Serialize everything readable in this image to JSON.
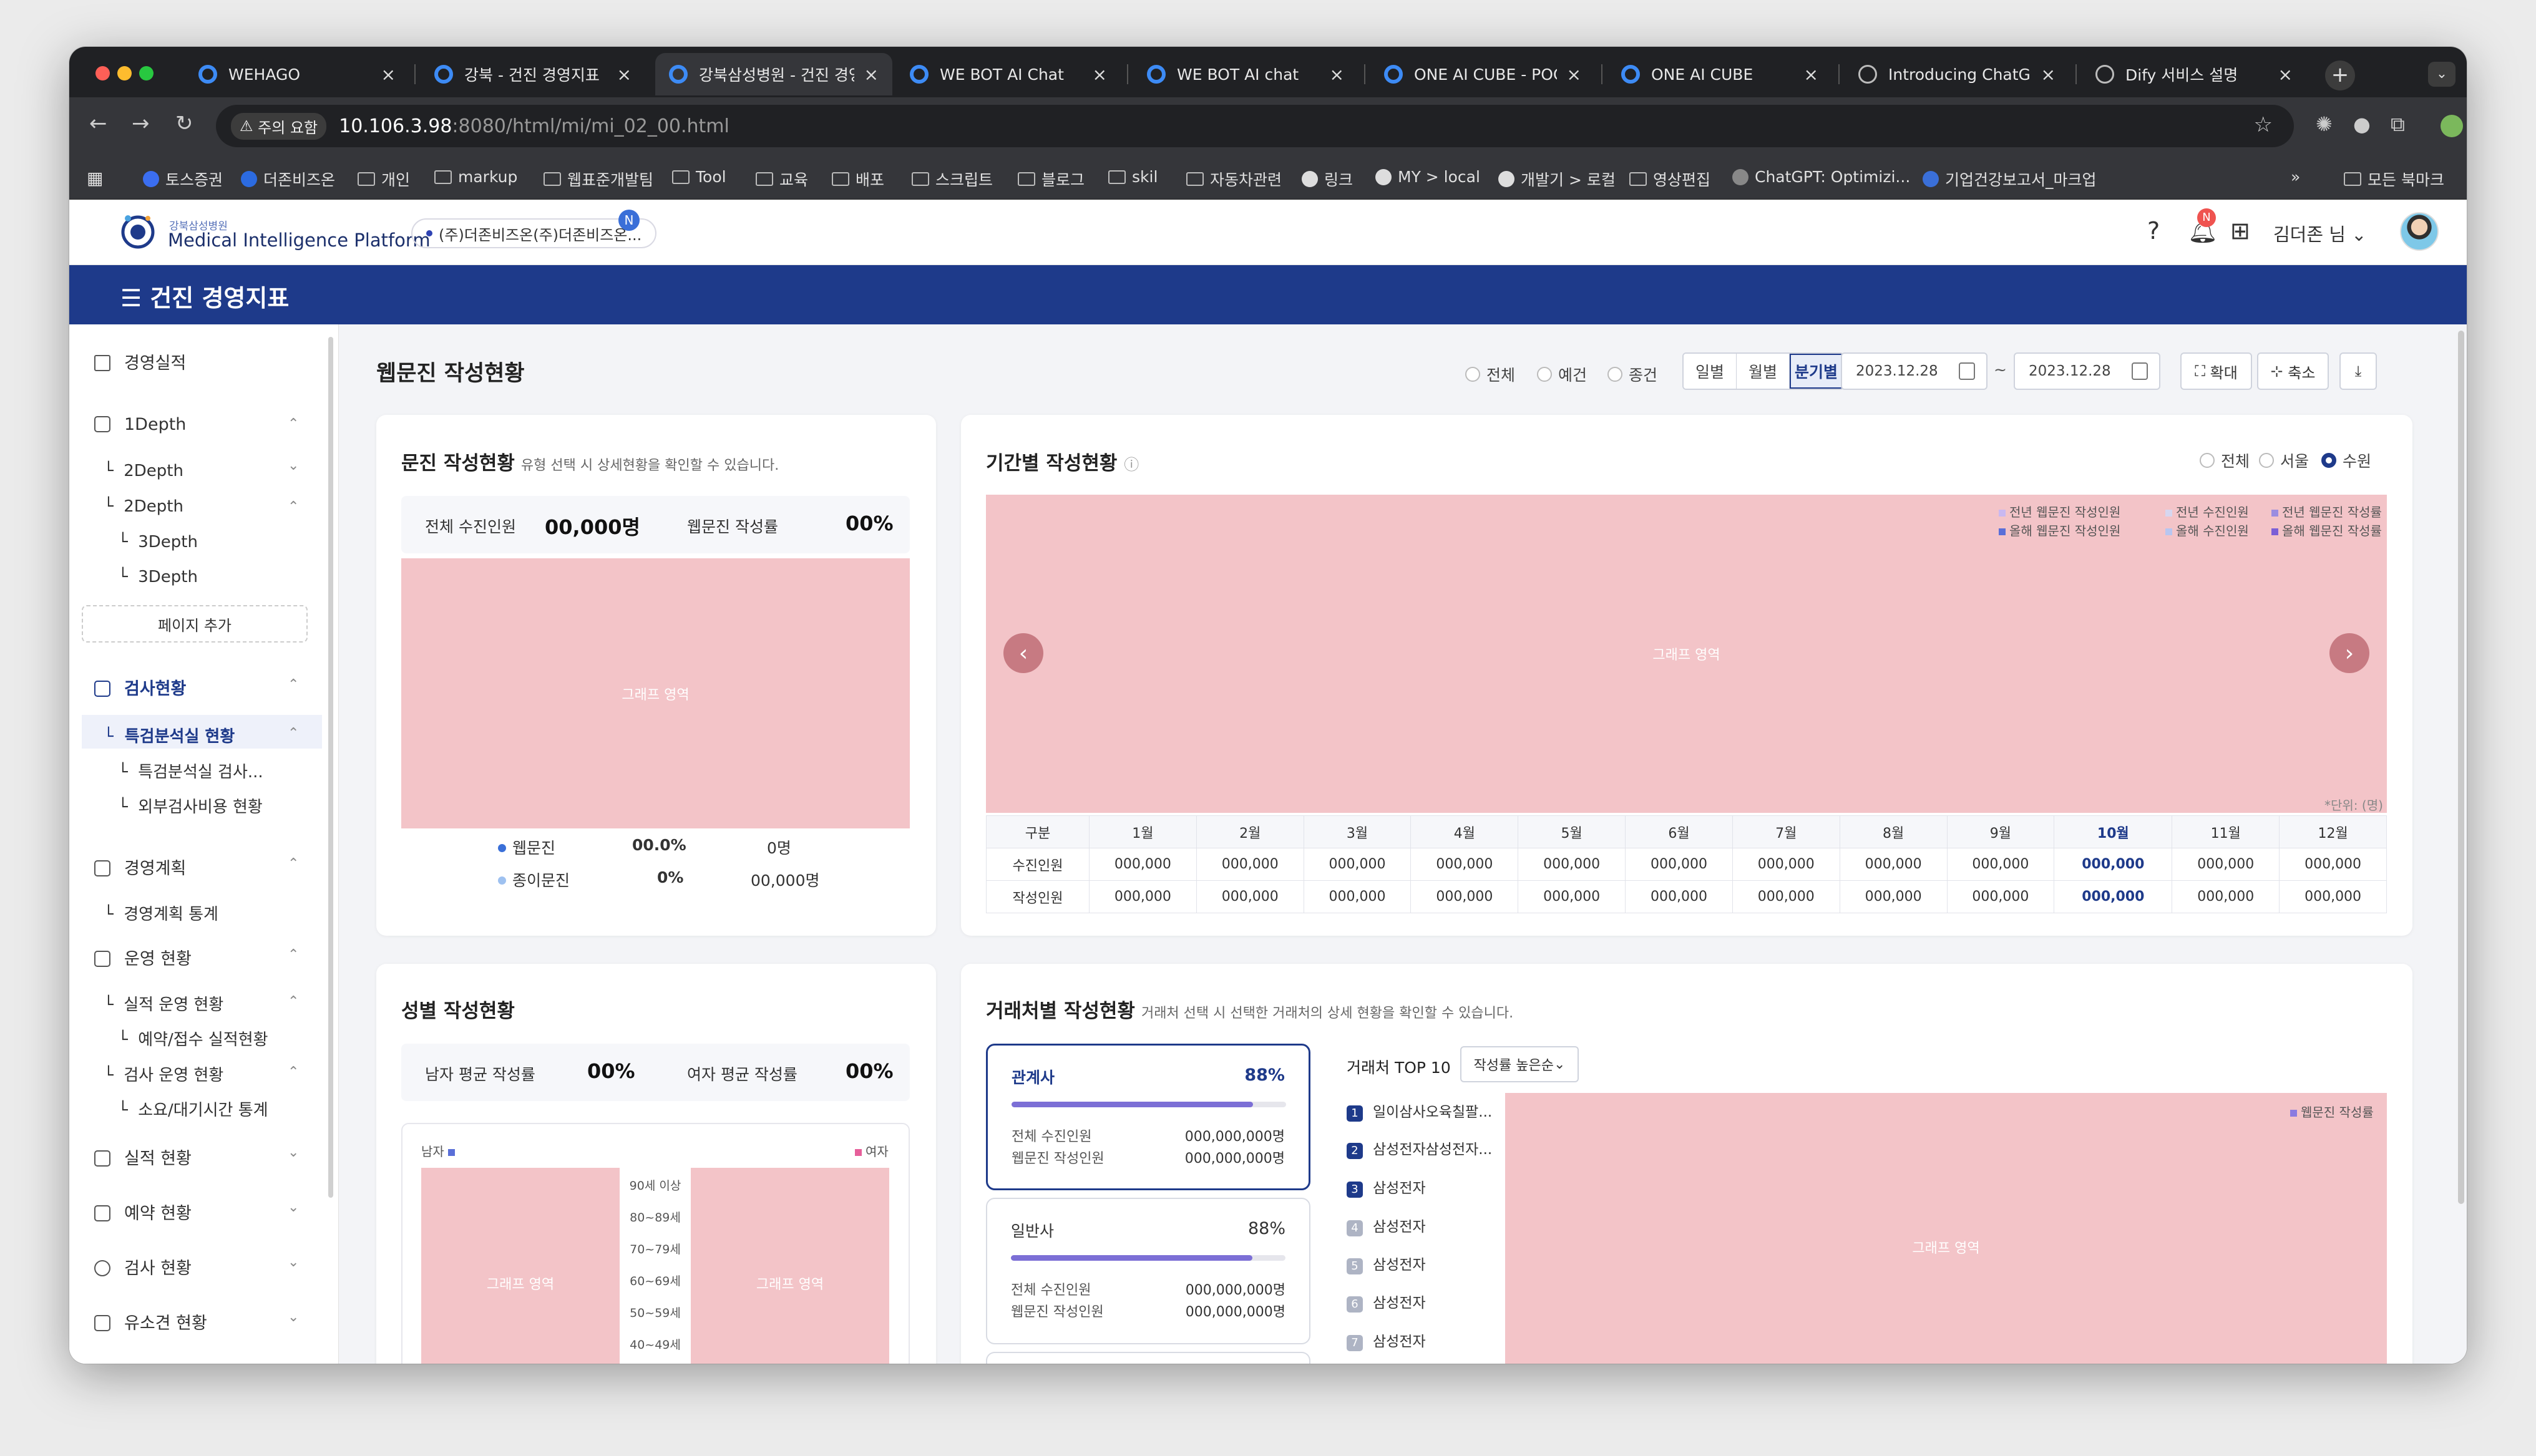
{
  "browser": {
    "tabs": [
      {
        "title": "WEHAGO"
      },
      {
        "title": "강북 - 건진 경영지표"
      },
      {
        "title": "강북삼성병원 - 건진 경영지"
      },
      {
        "title": "WE BOT AI Chat"
      },
      {
        "title": "WE BOT AI chat"
      },
      {
        "title": "ONE AI CUBE - POC"
      },
      {
        "title": "ONE AI CUBE"
      },
      {
        "title": "Introducing ChatGPT"
      },
      {
        "title": "Dify 서비스 설명"
      }
    ],
    "warning": "주의 요함",
    "url_host": "10.106.3.98",
    "url_path": ":8080/html/mi/mi_02_00.html",
    "bookmarks": [
      "토스증권",
      "더존비즈온",
      "개인",
      "markup",
      "웹표준개발팀",
      "Tool",
      "교육",
      "배포",
      "스크립트",
      "블로그",
      "skil",
      "자동차관련",
      "링크",
      "MY > local",
      "개발기 > 로컬",
      "영상편집",
      "ChatGPT: Optimizi...",
      "기업건강보고서_마크업"
    ],
    "all_bookmarks": "모든 북마크"
  },
  "header": {
    "logo_sub": "강북삼성병원",
    "logo_main": "Medical Intelligence Platform",
    "org": "(주)더존비즈온(주)더존비즈온...",
    "org_badge": "N",
    "bell_badge": "N",
    "user": "김더존 님",
    "menu_title": "건진 경영지표"
  },
  "sidebar": {
    "s1": "경영실적",
    "s2": "1Depth",
    "s3": "2Depth",
    "s4": "2Depth",
    "s5": "3Depth",
    "s6": "3Depth",
    "add_page": "페이지 추가",
    "s7": "검사현황",
    "s8": "특검분석실 현황",
    "s9": "특검분석실 검사...",
    "s10": "외부검사비용 현황",
    "s11": "경영계획",
    "s12": "경영계획 통계",
    "s13": "운영 현황",
    "s14": "실적 운영 현황",
    "s15": "예약/접수 실적현황",
    "s16": "검사 운영 현황",
    "s17": "소요/대기시간 통계",
    "s18": "실적 현황",
    "s19": "예약 현황",
    "s20": "검사 현황",
    "s21": "유소견 현황"
  },
  "page": {
    "title": "웹문진 작성현황",
    "filter": [
      "전체",
      "예건",
      "종건"
    ],
    "period": [
      "일별",
      "월별",
      "분기별"
    ],
    "date_from": "2023.12.28",
    "tilde": "~",
    "date_to": "2023.12.28",
    "expand": "확대",
    "shrink": "축소"
  },
  "card1": {
    "title": "문진 작성현황",
    "desc": "유형 선택 시 상세현황을 확인할 수 있습니다.",
    "total_label": "전체 수진인원",
    "total_value": "00,000명",
    "rate_label": "웹문진 작성률",
    "rate_value": "00%",
    "graph": "그래프 영역",
    "legend": [
      {
        "name": "웹문진",
        "pct": "00.0%",
        "count": "0명",
        "color": "#3a6fd8"
      },
      {
        "name": "종이문진",
        "pct": "0%",
        "count": "00,000명",
        "color": "#9ec1f0"
      }
    ]
  },
  "card2": {
    "title": "기간별 작성현황",
    "region": [
      "전체",
      "서울",
      "수원"
    ],
    "graph": "그래프 영역",
    "legend": [
      {
        "name": "전년 웹문진 작성인원",
        "color": "#c9b8f0"
      },
      {
        "name": "전년 수진인원",
        "color": "#d6d6ef"
      },
      {
        "name": "전년 웹문진 작성률",
        "color": "#9b8de0"
      },
      {
        "name": "올해 웹문진 작성인원",
        "color": "#5a6fd8"
      },
      {
        "name": "올해 수진인원",
        "color": "#b8c6f0"
      },
      {
        "name": "올해 웹문진 작성률",
        "color": "#7b5fd6"
      }
    ],
    "unit": "*단위: (명)",
    "table_head": [
      "구분",
      "1월",
      "2월",
      "3월",
      "4월",
      "5월",
      "6월",
      "7월",
      "8월",
      "9월",
      "10월",
      "11월",
      "12월"
    ],
    "row1_label": "수진인원",
    "row2_label": "작성인원",
    "cell": "000,000"
  },
  "card3": {
    "title": "성별 작성현황",
    "male_label": "남자 평균 작성률",
    "male_value": "00%",
    "female_label": "여자 평균 작성률",
    "female_value": "00%",
    "male": "남자",
    "female": "여자",
    "graph": "그래프 영역",
    "ages": [
      "90세 이상",
      "80~89세",
      "70~79세",
      "60~69세",
      "50~59세",
      "40~49세"
    ]
  },
  "card4": {
    "title": "거래처별 작성현황",
    "desc": "거래처 선택 시 선택한 거래처의 상세 현황을 확인할 수 있습니다.",
    "companies": [
      {
        "name": "관계사",
        "pct": "88%",
        "progress": 0.88,
        "r1": "전체 수진인원",
        "v1": "000,000,000명",
        "r2": "웹문진 작성인원",
        "v2": "000,000,000명"
      },
      {
        "name": "일반사",
        "pct": "88%",
        "progress": 0.88,
        "r1": "전체 수진인원",
        "v1": "000,000,000명",
        "r2": "웹문진 작성인원",
        "v2": "000,000,000명"
      }
    ],
    "top10_title": "거래처 TOP 10",
    "sort": "작성률 높은순",
    "top10": [
      "일이삼사오육칠팔...",
      "삼성전자삼성전자...",
      "삼성전자",
      "삼성전자",
      "삼성전자",
      "삼성전자",
      "삼성전자"
    ],
    "legend": "웹문진 작성률",
    "graph": "그래프 영역"
  }
}
